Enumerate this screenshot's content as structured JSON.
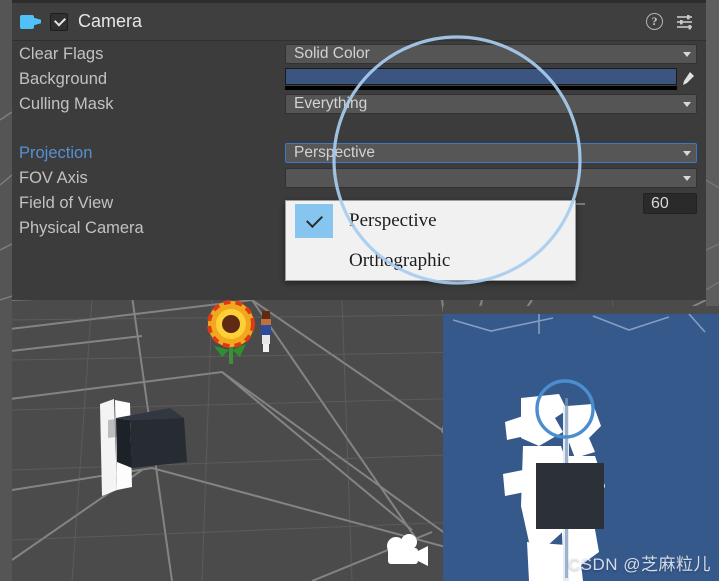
{
  "window": {
    "app": "Unity Editor",
    "panel_name": "Inspector"
  },
  "colors": {
    "panel_bg": "#3c3c3c",
    "field_bg": "#555555",
    "accent_blue": "#5790d2",
    "focus_border": "#3c79c4",
    "background_color_swatch": "#3b5480",
    "camera_icon": "#4fc3f7",
    "popup_bg": "#f1f1f1",
    "popup_highlight": "#86c5ef",
    "game_bg": "#36598c",
    "annotation": "#a8cdf0",
    "scene_bg": "#4b4b4b"
  },
  "header": {
    "component_icon": "video-camera-icon",
    "enabled": true,
    "enabled_checkbox_icon": "checkmark-icon",
    "title": "Camera",
    "help_icon": "help-question-icon",
    "help_glyph": "?",
    "preset_icon": "preset-settings-sliders-icon"
  },
  "properties": [
    {
      "label": "Clear Flags",
      "control": "dropdown",
      "value": "Solid Color",
      "active": false,
      "name": "clear-flags"
    },
    {
      "label": "Background",
      "control": "color",
      "value": "#3b5480",
      "alpha_bar": "#000000",
      "eyedropper_icon": "eyedropper-icon",
      "active": false,
      "name": "background"
    },
    {
      "label": "Culling Mask",
      "control": "dropdown",
      "value": "Everything",
      "active": false,
      "name": "culling-mask"
    },
    {
      "label": "Projection",
      "control": "dropdown",
      "value": "Perspective",
      "active": true,
      "focused": true,
      "name": "projection"
    },
    {
      "label": "FOV Axis",
      "control": "dropdown",
      "value": "",
      "active": false,
      "name": "fov-axis"
    },
    {
      "label": "Field of View",
      "control": "slider",
      "value": "60",
      "active": false,
      "name": "field-of-view"
    },
    {
      "label": "Physical Camera",
      "control": "checkbox",
      "value": "",
      "checked": false,
      "active": false,
      "name": "physical-camera"
    }
  ],
  "dropdown_popup": {
    "open": true,
    "owner": "Projection",
    "selected": "Perspective",
    "options": [
      {
        "label": "Perspective",
        "checked": true,
        "check_icon": "checkmark-icon"
      },
      {
        "label": "Orthographic",
        "checked": false,
        "check_icon": ""
      }
    ]
  },
  "scene_view": {
    "name": "scene-view",
    "grid_visible": true,
    "gizmos": [
      {
        "name": "camera-gizmo-icon"
      },
      {
        "name": "sunflower-sprite"
      },
      {
        "name": "character-sprite"
      },
      {
        "name": "white-plane-sprite"
      },
      {
        "name": "dark-cube-mesh"
      }
    ]
  },
  "game_view": {
    "name": "game-preview",
    "background": "#36598c",
    "watermark": "CSDN @芝麻粒儿"
  },
  "annotations": [
    {
      "name": "annotation-circle-projection",
      "shape": "circle"
    },
    {
      "name": "annotation-circle-game-preview",
      "shape": "circle"
    }
  ]
}
